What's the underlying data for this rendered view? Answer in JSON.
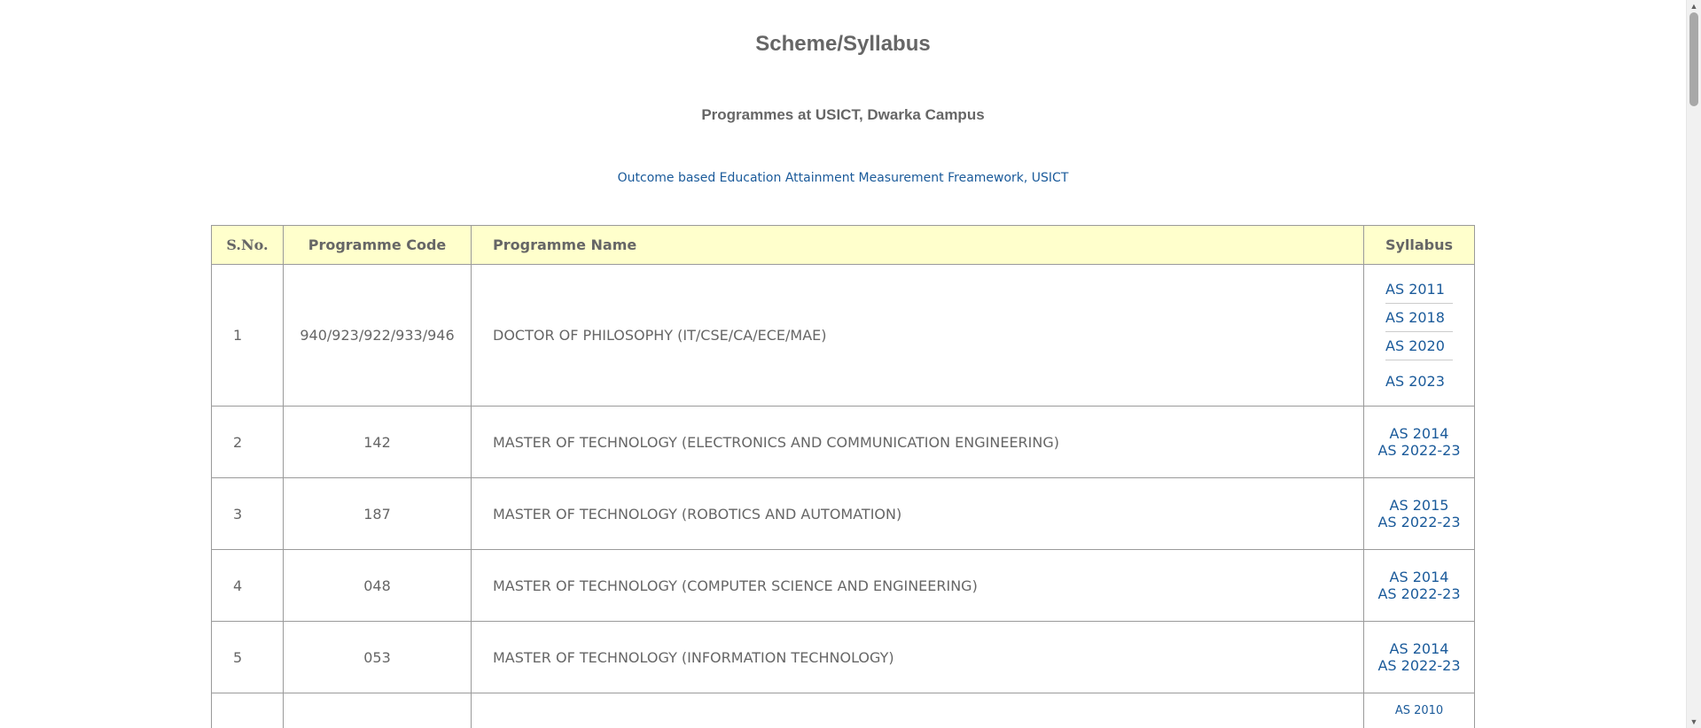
{
  "header": {
    "title": "Scheme/Syllabus",
    "subtitle": "Programmes at USICT, Dwarka Campus",
    "obe_link": "Outcome based Education Attainment Measurement Freamework, USICT"
  },
  "table": {
    "headers": {
      "sno": "S.No.",
      "code": "Programme Code",
      "name": "Programme Name",
      "syllabus": "Syllabus"
    },
    "rows": [
      {
        "sno": "1",
        "code": "940/923/922/933/946",
        "name": "DOCTOR OF PHILOSOPHY (IT/CSE/CA/ECE/MAE)",
        "syllabus": [
          "AS 2011",
          "AS 2018",
          "AS 2020",
          "AS 2023"
        ]
      },
      {
        "sno": "2",
        "code": "142",
        "name": "MASTER OF TECHNOLOGY (ELECTRONICS AND COMMUNICATION ENGINEERING)",
        "syllabus": [
          "AS 2014",
          "AS 2022-23"
        ]
      },
      {
        "sno": "3",
        "code": "187",
        "name": "MASTER OF TECHNOLOGY (ROBOTICS AND AUTOMATION)",
        "syllabus": [
          "AS 2015",
          "AS 2022-23"
        ]
      },
      {
        "sno": "4",
        "code": "048",
        "name": "MASTER OF TECHNOLOGY (COMPUTER SCIENCE AND ENGINEERING)",
        "syllabus": [
          "AS 2014",
          "AS 2022-23"
        ]
      },
      {
        "sno": "5",
        "code": "053",
        "name": "MASTER OF TECHNOLOGY (INFORMATION TECHNOLOGY)",
        "syllabus": [
          "AS 2014",
          "AS 2022-23"
        ]
      },
      {
        "sno": "",
        "code": "",
        "name": "",
        "syllabus": [
          "AS 2010"
        ]
      }
    ]
  },
  "scrollbar": {
    "up_icon": "triangle-up-icon",
    "down_icon": "triangle-down-icon"
  }
}
